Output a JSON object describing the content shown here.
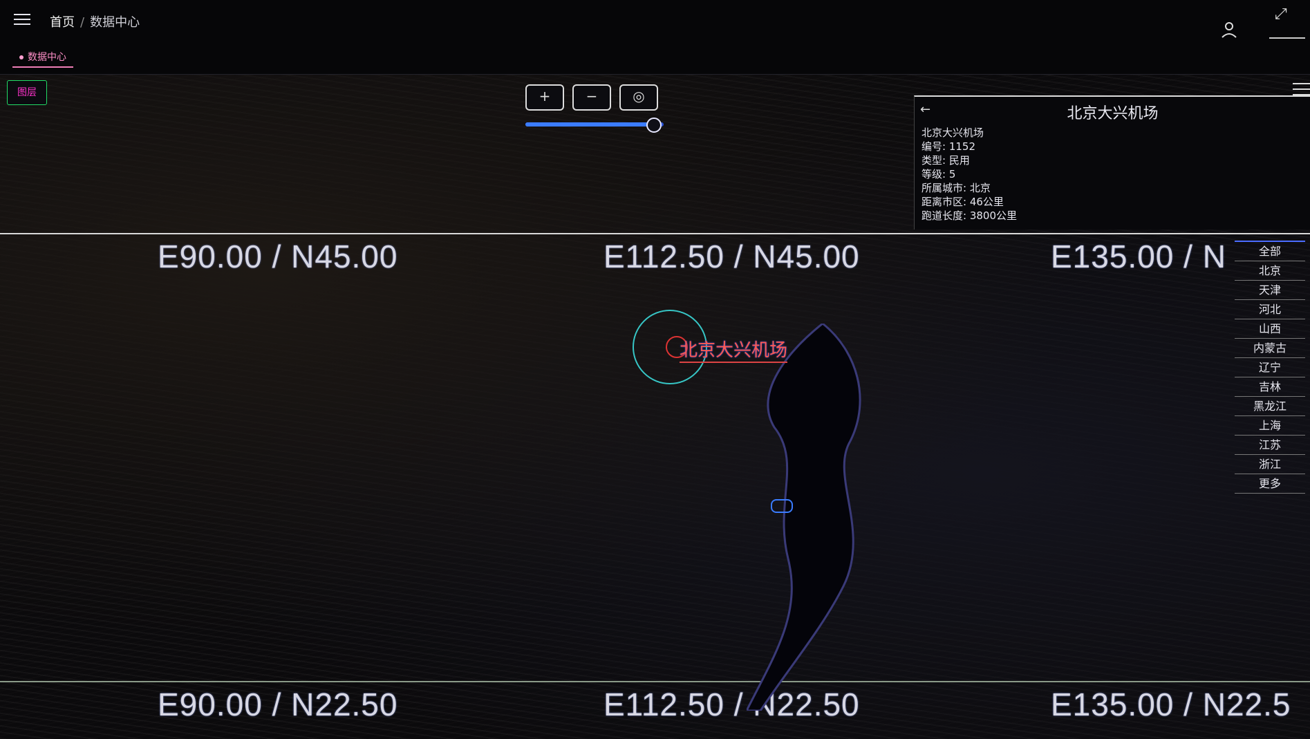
{
  "header": {
    "breadcrumb": [
      "首页",
      "数据中心"
    ],
    "separator": "/"
  },
  "tabs": [
    {
      "label": "数据中心",
      "active": true
    }
  ],
  "map": {
    "layer_button_label": "图层",
    "grid_labels": {
      "top_left": "E90.00 / N45.00",
      "top_center": "E112.50 / N45.00",
      "top_right": "E135.00 / N",
      "bottom_left": "E90.00 / N22.50",
      "bottom_center": "E112.50 / N22.50",
      "bottom_right": "E135.00 / N22.5"
    },
    "controls": {
      "zoom_in": "+",
      "zoom_out": "−",
      "reset": "◎"
    },
    "zoom_slider_fraction": 0.92,
    "marker": {
      "label": "北京大兴机场"
    },
    "colors": {
      "marker_ring": "#37c6c6",
      "marker_label": "#ff5a50",
      "slider": "#3b7cff",
      "tab_accent": "#f07fb8"
    }
  },
  "info_panel": {
    "back": "←",
    "title": "北京大兴机场",
    "rows": [
      "北京大兴机场",
      "编号: 1152",
      "类型: 民用",
      "等级: 5",
      "所属城市: 北京",
      "距离市区: 46公里",
      "跑道长度: 3800公里"
    ]
  },
  "side_list": {
    "items": [
      "全部",
      "北京",
      "天津",
      "河北",
      "山西",
      "内蒙古",
      "辽宁",
      "吉林",
      "黑龙江",
      "上海",
      "江苏",
      "浙江",
      "更多"
    ]
  }
}
